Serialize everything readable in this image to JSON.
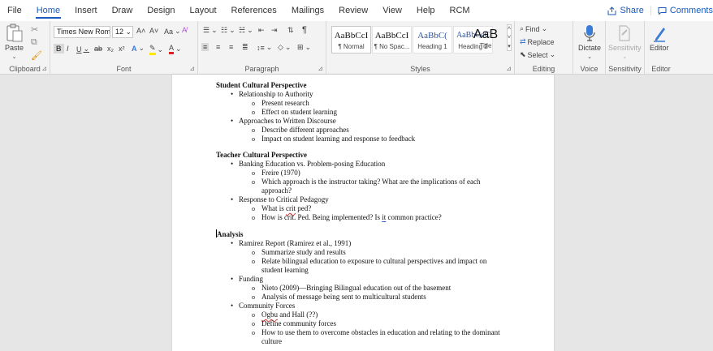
{
  "menu": {
    "tabs": [
      "File",
      "Home",
      "Insert",
      "Draw",
      "Design",
      "Layout",
      "References",
      "Mailings",
      "Review",
      "View",
      "Help",
      "RCM"
    ],
    "share": "Share",
    "comments": "Comments"
  },
  "ribbon": {
    "clipboard": {
      "label": "Clipboard",
      "paste": "Paste"
    },
    "font": {
      "label": "Font",
      "font_name": "Times New Rom",
      "font_size": "12",
      "change_case": "Aa"
    },
    "paragraph": {
      "label": "Paragraph"
    },
    "styles": {
      "label": "Styles",
      "items": [
        {
          "sample": "AaBbCcI",
          "name": "¶ Normal"
        },
        {
          "sample": "AaBbCcI",
          "name": "¶ No Spac..."
        },
        {
          "sample": "AaBbC(",
          "name": "Heading 1"
        },
        {
          "sample": "AaBbCcC",
          "name": "Heading 2"
        },
        {
          "sample": "AaB",
          "name": "Title"
        }
      ]
    },
    "editing": {
      "label": "Editing",
      "find": "Find",
      "replace": "Replace",
      "select": "Select"
    },
    "voice": {
      "label": "Voice",
      "dictate": "Dictate"
    },
    "sensitivity": {
      "label": "Sensitivity",
      "button": "Sensitivity"
    },
    "editor": {
      "label": "Editor",
      "button": "Editor"
    }
  },
  "document": {
    "s1": {
      "heading": "Student Cultural Perspective",
      "i1": "Relationship to Authority",
      "i1a": "Present research",
      "i1b": "Effect on student learning",
      "i2": "Approaches to Written Discourse",
      "i2a": "Describe different approaches",
      "i2b": "Impact on student learning and response to feedback"
    },
    "s2": {
      "heading": "Teacher Cultural Perspective",
      "i1": "Banking Education vs. Problem-posing Education",
      "i1a": "Freire (1970)",
      "i1b": "Which approach is the instructor taking? What are the implications of each approach?",
      "i2": "Response to Critical Pedagogy",
      "i2a_pre": "What is ",
      "i2a_spell": "crit",
      "i2a_post": " ped?",
      "i2b_pre": "How is crit. Ped. Being implemented? Is ",
      "i2b_spell": "it",
      "i2b_post": " common practice?"
    },
    "s3": {
      "heading": "Analysis",
      "i1": "Ramirez Report (Ramirez et al., 1991)",
      "i1a": "Summarize study and results",
      "i1b": "Relate bilingual education to exposure to cultural perspectives and impact on student learning",
      "i2": "Funding",
      "i2a": "Nieto (2009)—Bringing Bilingual education out of the basement",
      "i2b": "Analysis of message being sent to multicultural students",
      "i3": "Community Forces",
      "i3a_spell": "Ogbu",
      "i3a_post": " and Hall (??)",
      "i3b": "Define community forces",
      "i3c": "How to use them to overcome obstacles in education and relating to the dominant culture"
    }
  }
}
